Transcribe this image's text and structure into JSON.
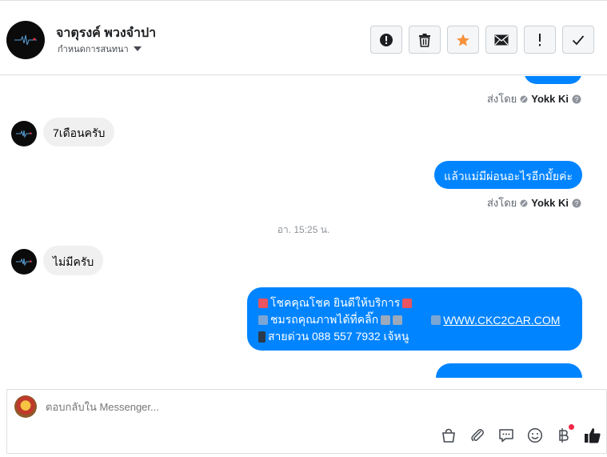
{
  "header": {
    "name": "จาตุรงค์ พวงจำปา",
    "subtitle": "กำหนดการสนทนา",
    "buttons": [
      {
        "name": "spam-button",
        "icon": "alert-circle-icon"
      },
      {
        "name": "delete-button",
        "icon": "trash-icon"
      },
      {
        "name": "star-button",
        "icon": "star-icon"
      },
      {
        "name": "mark-unread-button",
        "icon": "envelope-icon"
      },
      {
        "name": "follow-up-button",
        "icon": "exclamation-icon"
      },
      {
        "name": "done-button",
        "icon": "check-icon"
      }
    ]
  },
  "messages": {
    "sent_by_label": "ส่งโดย",
    "sender": "Yokk Ki",
    "in1": "7เดือนครับ",
    "out1": "แล้วแม่มีผ่อนอะไรอีกมั้ยค่ะ",
    "timestamp": "อา. 15:25 น.",
    "in2": "ไม่มีครับ",
    "promo": {
      "line1": "โชคคุณโชค ยินดีให้บริการ",
      "line2": "ชมรถคุณภาพได้ที่คลิ๊ก",
      "link": "WWW.CKC2CAR.COM",
      "line3": "สายด่วน 088 557 7932 เจ้หนู"
    }
  },
  "composer": {
    "placeholder": "ตอบกลับใน Messenger..."
  },
  "colors": {
    "accent": "#0084ff",
    "star": "#f7923b",
    "notification": "#f02849"
  }
}
